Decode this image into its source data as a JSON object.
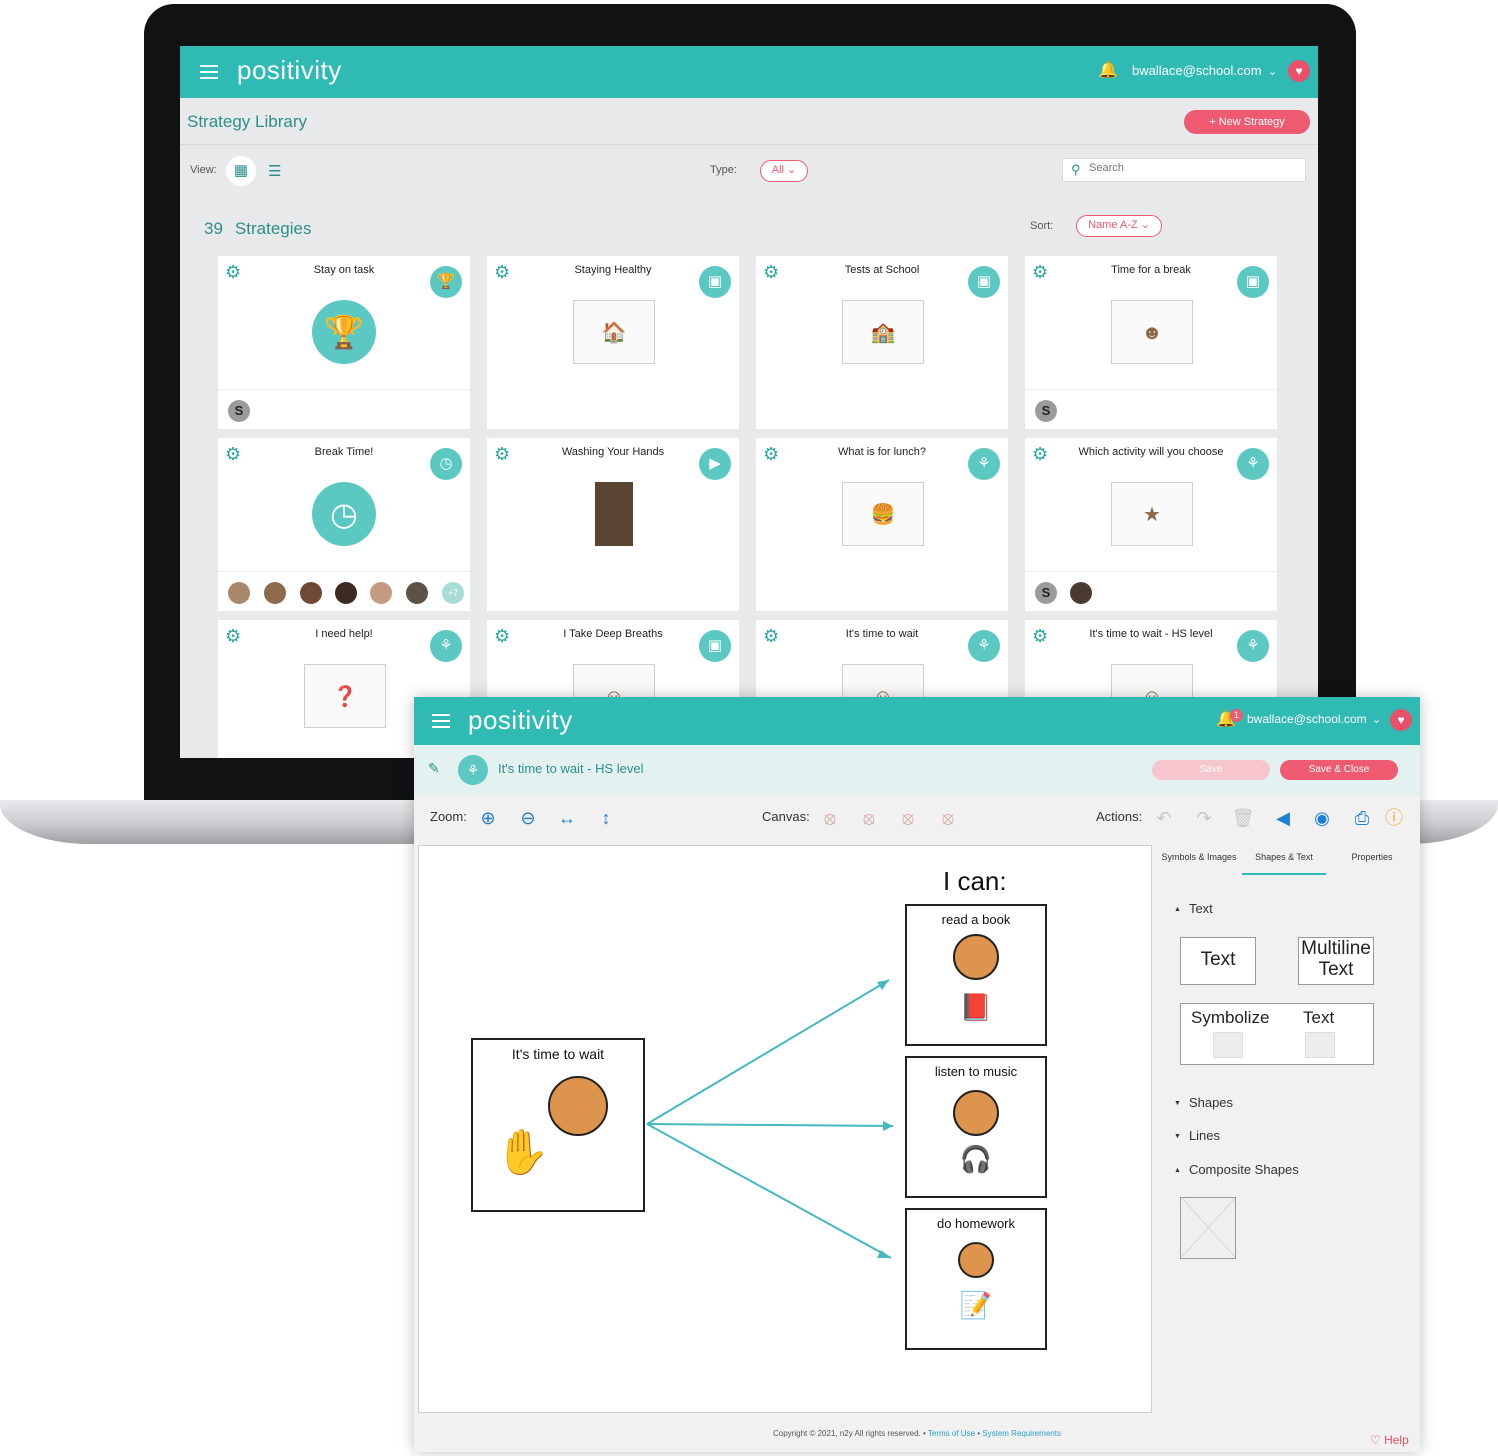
{
  "library": {
    "app_name": "positivity",
    "user_email": "bwallace@school.com",
    "page_title": "Strategy Library",
    "new_strategy_label": "+ New Strategy",
    "view_label": "View:",
    "type_label": "Type:",
    "type_value": "All",
    "search_placeholder": "Search",
    "count": "39",
    "count_label": "Strategies",
    "sort_label": "Sort:",
    "sort_value": "Name A-Z",
    "cards": [
      {
        "title": "Stay on task",
        "badge_icon": "trophy-icon",
        "avatars": [
          "S"
        ]
      },
      {
        "title": "Staying Healthy",
        "badge_icon": "image-icon"
      },
      {
        "title": "Tests at School",
        "badge_icon": "image-icon"
      },
      {
        "title": "Time for a break",
        "badge_icon": "image-icon",
        "avatars": [
          "S"
        ]
      },
      {
        "title": "Break Time!",
        "badge_icon": "clock-icon",
        "more_label": "+7"
      },
      {
        "title": "Washing Your Hands",
        "badge_icon": "play-icon"
      },
      {
        "title": "What is for lunch?",
        "badge_icon": "choice-board-icon"
      },
      {
        "title": "Which activity will you choose",
        "badge_icon": "choice-board-icon",
        "avatars": [
          "S"
        ]
      },
      {
        "title": "I need help!",
        "badge_icon": "choice-board-icon"
      },
      {
        "title": "I Take Deep Breaths",
        "badge_icon": "image-icon"
      },
      {
        "title": "It's time to wait",
        "badge_icon": "choice-board-icon"
      },
      {
        "title": "It's time to wait - HS level",
        "badge_icon": "choice-board-icon"
      }
    ]
  },
  "editor": {
    "app_name": "positivity",
    "user_email": "bwallace@school.com",
    "notification_count": "1",
    "strategy_title": "It's time to wait - HS level",
    "save_label": "Save",
    "save_close_label": "Save & Close",
    "zoom_label": "Zoom:",
    "canvas_label": "Canvas:",
    "actions_label": "Actions:",
    "canvas": {
      "heading": "I can:",
      "source_symbol": "It's time to wait",
      "choices": [
        "read a book",
        "listen to music",
        "do homework"
      ]
    },
    "panel": {
      "tabs": [
        "Symbols & Images",
        "Shapes & Text",
        "Properties"
      ],
      "active_tab": "Shapes & Text",
      "sections": {
        "text": "Text",
        "shapes": "Shapes",
        "lines": "Lines",
        "composite": "Composite Shapes"
      },
      "text_tools": {
        "text": "Text",
        "multiline_1": "Multiline",
        "multiline_2": "Text",
        "symbolize": "Symbolize",
        "symbolize_text": "Text"
      }
    },
    "footer": {
      "copyright": "Copyright © 2021, n2y All rights reserved. • ",
      "terms": "Terms of Use",
      "sep": " • ",
      "requirements": "System Requirements",
      "help": "♡ Help"
    }
  },
  "colors": {
    "brand_teal": "#2fbab3",
    "accent_pink": "#ee5a6f",
    "title_teal": "#2c8f8b"
  }
}
